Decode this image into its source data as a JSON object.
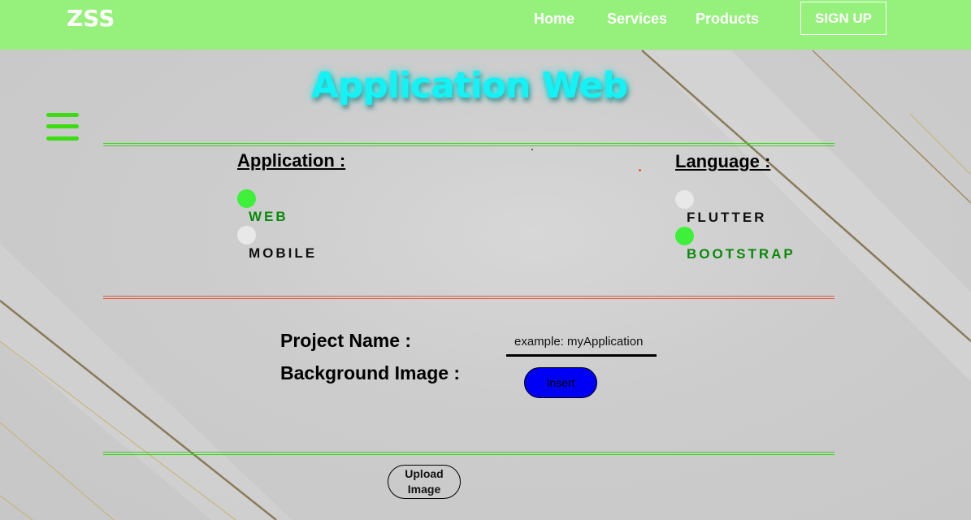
{
  "navbar": {
    "logo": "ZSS",
    "links": [
      "Home",
      "Services",
      "Products"
    ],
    "signup_label": "SIGN UP",
    "bg_color": "#96f07c"
  },
  "title": "Application Web",
  "application": {
    "heading": "Application :",
    "options": [
      {
        "label": "WEB",
        "selected": true
      },
      {
        "label": "MOBILE",
        "selected": false
      }
    ]
  },
  "language": {
    "heading": "Language :",
    "options": [
      {
        "label": "FLUTTER",
        "selected": false
      },
      {
        "label": "BOOTSTRAP",
        "selected": true
      }
    ]
  },
  "form": {
    "project_name_label": "Project Name :",
    "project_name_placeholder": "example: myApplication",
    "background_image_label": "Background Image :",
    "insert_label": "Insert",
    "upload_label": "Upload Image"
  },
  "colors": {
    "accent_green": "#3bdc12",
    "title_cyan": "#13f2f5",
    "selected_radio": "#3ff03a",
    "insert_blue": "#0000f6"
  }
}
